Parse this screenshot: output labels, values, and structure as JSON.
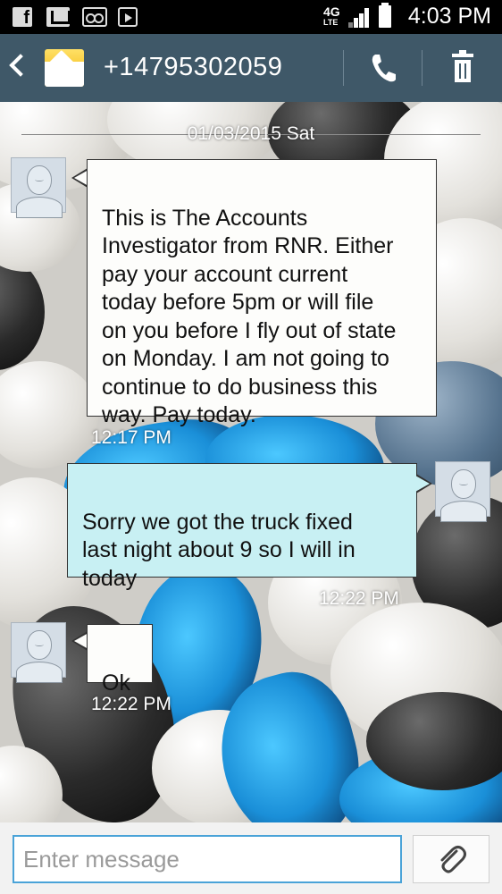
{
  "status_bar": {
    "time": "4:03 PM",
    "network_label": "4G",
    "network_sub": "LTE",
    "icons": [
      "facebook-icon",
      "gmail-icon",
      "voicemail-icon",
      "play-store-icon",
      "signal-icon",
      "battery-icon"
    ]
  },
  "header": {
    "contact_number": "+14795302059",
    "icons": [
      "back-icon",
      "envelope-icon",
      "phone-icon",
      "trash-icon"
    ],
    "color": "#3f5868"
  },
  "conversation": {
    "date_divider": "01/03/2015 Sat",
    "messages": [
      {
        "direction": "incoming",
        "text": "This is The Accounts\nInvestigator from RNR. Either\npay your account current\ntoday before 5pm or will file\non you before I fly out of state\non Monday. I am not going to\ncontinue to do business this\nway. Pay today.",
        "time": "12:17 PM"
      },
      {
        "direction": "outgoing",
        "text": "Sorry we got the truck fixed\nlast night about 9 so I will in\ntoday",
        "time": "12:22 PM"
      },
      {
        "direction": "incoming",
        "text": "Ok",
        "time": "12:22 PM"
      }
    ],
    "incoming_bubble_color": "#fdfdfb",
    "outgoing_bubble_color": "#c8f0f3"
  },
  "composer": {
    "placeholder": "Enter message",
    "attach_icon": "paperclip-icon"
  }
}
